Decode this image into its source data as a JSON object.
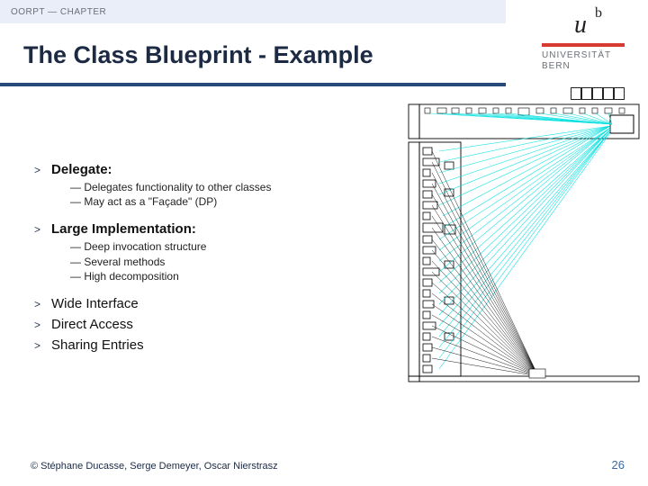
{
  "header": {
    "tag": "OORPT — CHAPTER"
  },
  "title": "The Class Blueprint - Example",
  "logo": {
    "uni1": "UNIVERSITÄT",
    "uni2": "BERN"
  },
  "bullets": [
    {
      "label": "Delegate:",
      "bold": true,
      "subs": [
        "Delegates functionality to other classes",
        "May act as a \"Façade\" (DP)"
      ]
    },
    {
      "label": "Large Implementation:",
      "bold": true,
      "subs": [
        "Deep invocation structure",
        "Several methods",
        "High decomposition"
      ]
    },
    {
      "label": "Wide Interface",
      "bold": false
    },
    {
      "label": "Direct Access",
      "bold": false
    },
    {
      "label": "Sharing Entries",
      "bold": false
    }
  ],
  "footer": {
    "copyright": "© Stéphane Ducasse, Serge Demeyer, Oscar Nierstrasz",
    "page": "26"
  }
}
